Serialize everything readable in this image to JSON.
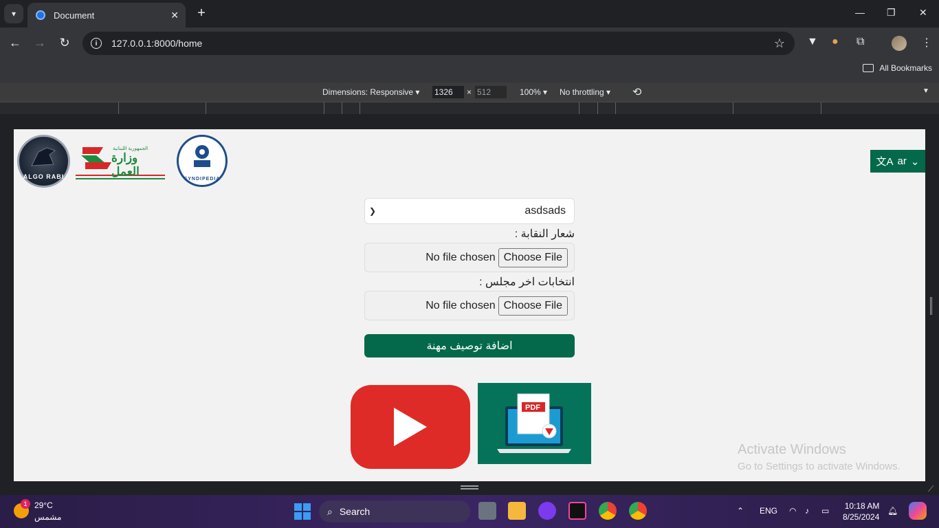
{
  "browser": {
    "tab_title": "Document",
    "url": "127.0.0.1:8000/home",
    "all_bookmarks": "All Bookmarks"
  },
  "devtools": {
    "dimensions": "Dimensions: Responsive",
    "width": "1326",
    "height": "512",
    "times": "×",
    "zoom": "100%",
    "throttling": "No throttling"
  },
  "page": {
    "logo_algo_text": "ALGO RABI",
    "logo_ministry_top": "الجمهورية اللبنانية",
    "logo_ministry_main": "وزارة العمل",
    "logo_syndipedia_text": "SYNDIPEDIA",
    "lang_label": "ar",
    "select_value": "asdsads",
    "label_logo": "شعار النقابة :",
    "label_elections": "انتخابات اخر مجلس :",
    "file_no_chosen": "No file chosen",
    "file_choose": "Choose File",
    "submit": "اضافة توصيف مهنة",
    "pdf_label": "PDF"
  },
  "watermark": {
    "line1": "Activate Windows",
    "line2": "Go to Settings to activate Windows."
  },
  "taskbar": {
    "temperature": "29°C",
    "weather": "مشمس",
    "notif_count": "1",
    "search": "Search",
    "lang": "ENG",
    "time": "10:18 AM",
    "date": "8/25/2024"
  },
  "colors": {
    "brand_green": "#04694a",
    "youtube_red": "#de2b27",
    "pdf_green": "#05735a"
  }
}
